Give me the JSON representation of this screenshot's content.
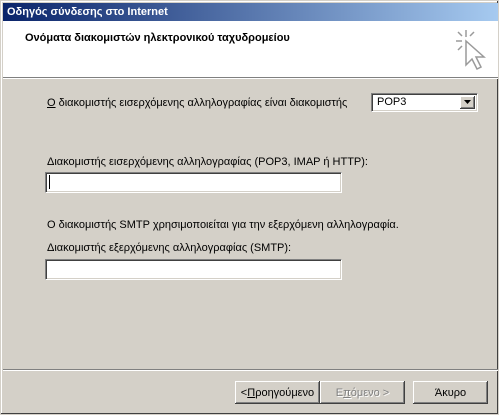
{
  "window": {
    "title": "Οδηγός σύνδεσης στο Internet",
    "header_title": "Ονόματα διακομιστών ηλεκτρονικού ταχυδρομείου"
  },
  "incoming_type": {
    "label_accel": "Ο",
    "label_rest": " διακομιστής εισερχόμενης αλληλογραφίας είναι διακομιστής",
    "selected": "POP3"
  },
  "incoming_server": {
    "label_pre": "Διακομιστής εισερ",
    "label_accel": "χ",
    "label_post": "όμενης αλληλογραφίας (POP3, IMAP ή HTTP):",
    "value": ""
  },
  "smtp_note": "Ο διακομιστής SMTP χρησιμοποιείται για την εξερχόμενη αλληλογραφία.",
  "outgoing_server": {
    "label_pre": "Διακομιστής εξερ",
    "label_accel": "χ",
    "label_post": "όμενης αλληλογραφίας (SMTP):",
    "value": ""
  },
  "buttons": {
    "back_prefix": "< ",
    "back_accel": "Π",
    "back_rest": "ροηγούμενο",
    "next_pre": "Ε",
    "next_accel": "π",
    "next_rest": "όμενο >",
    "cancel": "Άκυρο"
  },
  "icons": {
    "header": "wizard-cursor-sparkle-icon",
    "dropdown": "chevron-down-icon"
  }
}
